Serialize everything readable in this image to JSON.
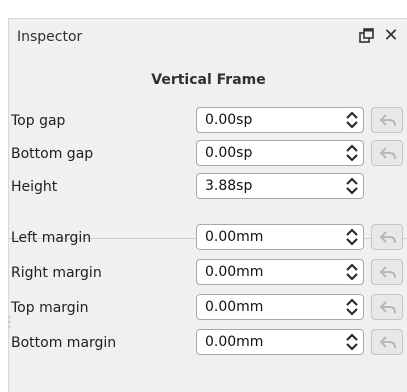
{
  "panel": {
    "title": "Inspector",
    "section_title": "Vertical Frame"
  },
  "icons": {
    "float": "float-window-icon",
    "close": "close-icon",
    "spin": "spin-arrows-icon",
    "reset": "reset-undo-icon"
  },
  "fields": [
    {
      "label": "Top gap",
      "value": "0.00sp",
      "has_reset": true
    },
    {
      "label": "Bottom gap",
      "value": "0.00sp",
      "has_reset": true
    },
    {
      "label": "Height",
      "value": "3.88sp",
      "has_reset": false
    },
    {
      "label": "Left margin",
      "value": "0.00mm",
      "has_reset": true
    },
    {
      "label": "Right margin",
      "value": "0.00mm",
      "has_reset": true
    },
    {
      "label": "Top margin",
      "value": "0.00mm",
      "has_reset": true
    },
    {
      "label": "Bottom margin",
      "value": "0.00mm",
      "has_reset": true
    }
  ],
  "close_glyph": "✕",
  "colors": {
    "panel_bg": "#f0f0f0",
    "field_border": "#a8a8a8",
    "reset_icon": "#b8b8b8"
  }
}
